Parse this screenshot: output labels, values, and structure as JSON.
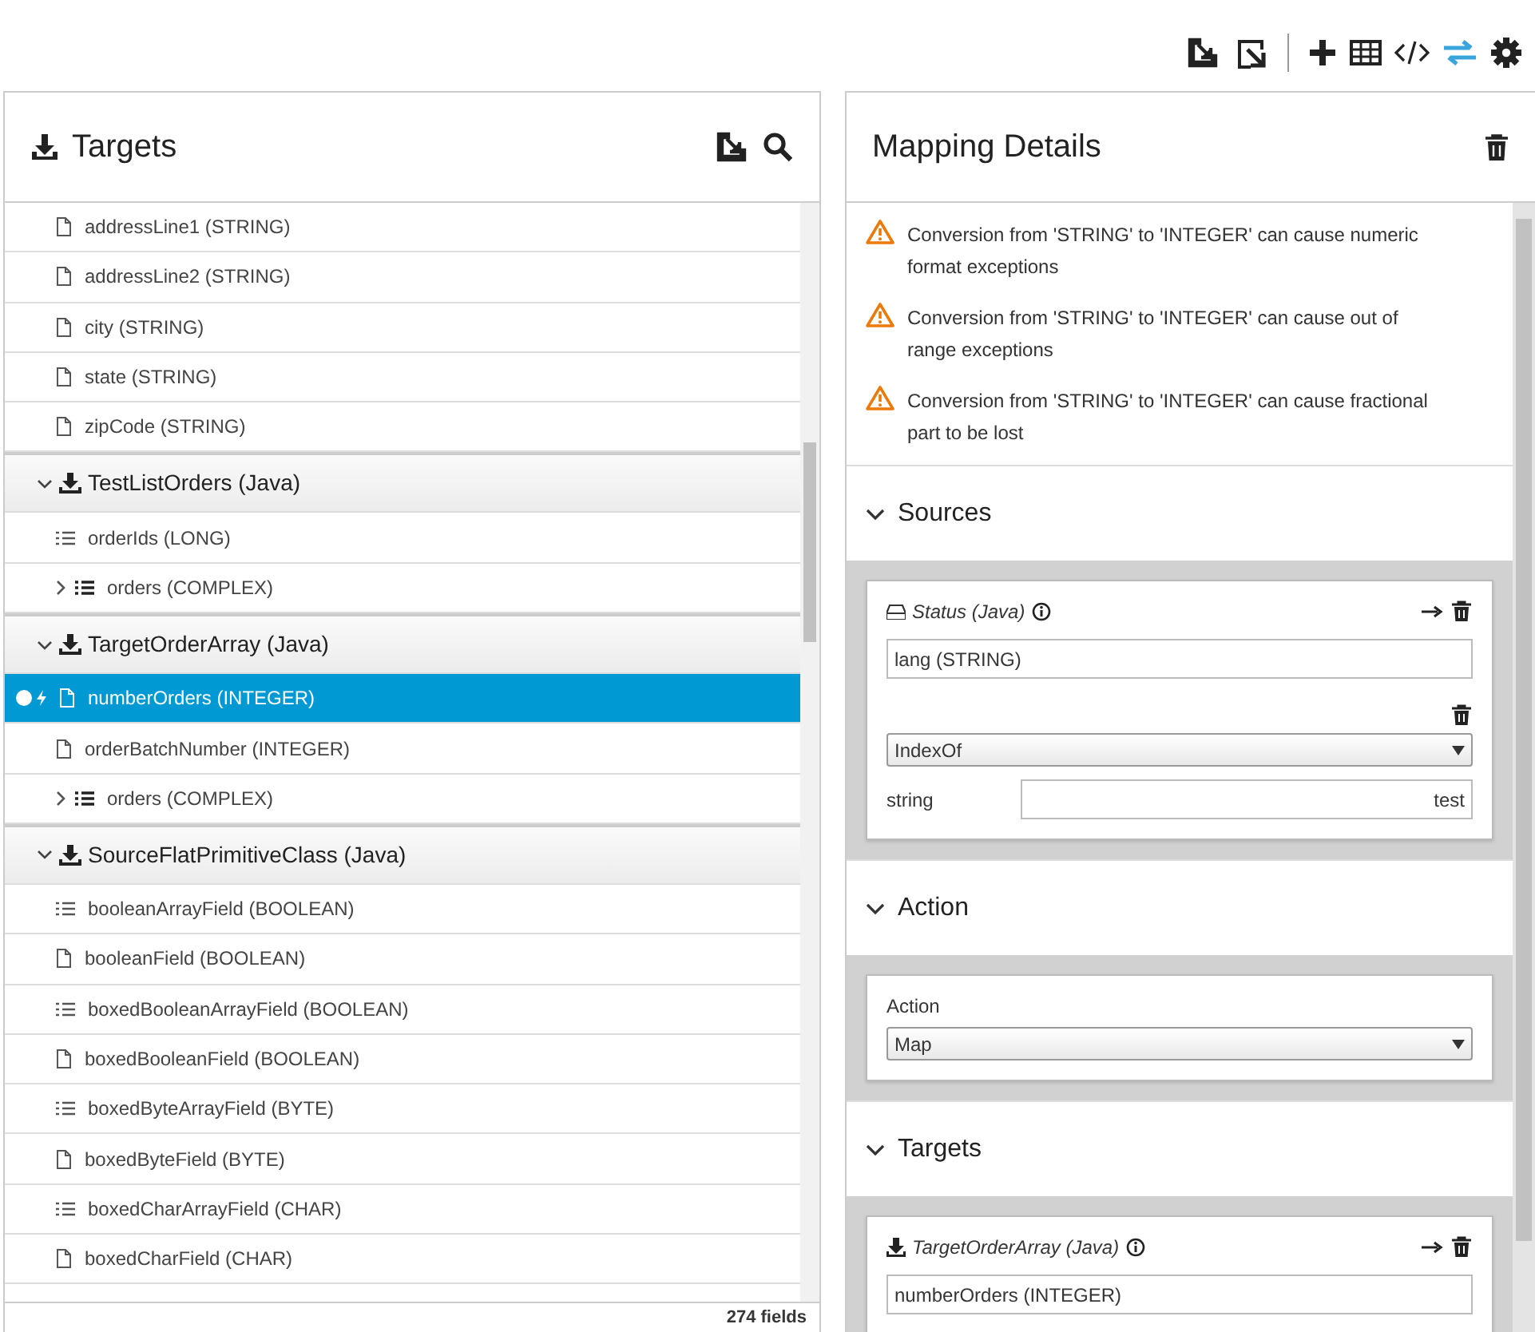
{
  "toolbar": [
    {
      "kind": "import",
      "active": false
    },
    {
      "kind": "export",
      "active": false
    },
    {
      "kind": "separator"
    },
    {
      "kind": "add",
      "active": false
    },
    {
      "kind": "table",
      "active": false
    },
    {
      "kind": "code",
      "active": false
    },
    {
      "kind": "mappings",
      "active": true
    },
    {
      "kind": "settings",
      "active": false
    }
  ],
  "targets_panel": {
    "title": "Targets",
    "footer": "274 fields",
    "tree": [
      {
        "kind": "field",
        "label": "addressLine1 (STRING)",
        "selected": false,
        "mapped": false
      },
      {
        "kind": "field",
        "label": "addressLine2 (STRING)",
        "selected": false,
        "mapped": false
      },
      {
        "kind": "field",
        "label": "city (STRING)",
        "selected": false,
        "mapped": false
      },
      {
        "kind": "field",
        "label": "state (STRING)",
        "selected": false,
        "mapped": false
      },
      {
        "kind": "field",
        "label": "zipCode (STRING)",
        "selected": false,
        "mapped": false
      },
      {
        "kind": "group",
        "label": "TestListOrders (Java)",
        "expanded": true,
        "children": [
          {
            "kind": "collection",
            "label": "orderIds (LONG)",
            "selected": false,
            "mapped": false
          },
          {
            "kind": "complex",
            "label": "orders (COMPLEX)",
            "selected": false,
            "mapped": false,
            "expanded": false
          }
        ]
      },
      {
        "kind": "group",
        "label": "TargetOrderArray (Java)",
        "expanded": true,
        "children": [
          {
            "kind": "field",
            "label": "numberOrders (INTEGER)",
            "selected": true,
            "mapped": true
          },
          {
            "kind": "field",
            "label": "orderBatchNumber (INTEGER)",
            "selected": false,
            "mapped": false
          },
          {
            "kind": "complex",
            "label": "orders (COMPLEX)",
            "selected": false,
            "mapped": false,
            "expanded": false
          }
        ]
      },
      {
        "kind": "group",
        "label": "SourceFlatPrimitiveClass (Java)",
        "expanded": true,
        "children": [
          {
            "kind": "collection",
            "label": "booleanArrayField (BOOLEAN)",
            "selected": false,
            "mapped": false
          },
          {
            "kind": "field",
            "label": "booleanField (BOOLEAN)",
            "selected": false,
            "mapped": false
          },
          {
            "kind": "collection",
            "label": "boxedBooleanArrayField (BOOLEAN)",
            "selected": false,
            "mapped": false
          },
          {
            "kind": "field",
            "label": "boxedBooleanField (BOOLEAN)",
            "selected": false,
            "mapped": false
          },
          {
            "kind": "collection",
            "label": "boxedByteArrayField (BYTE)",
            "selected": false,
            "mapped": false
          },
          {
            "kind": "field",
            "label": "boxedByteField (BYTE)",
            "selected": false,
            "mapped": false
          },
          {
            "kind": "collection",
            "label": "boxedCharArrayField (CHAR)",
            "selected": false,
            "mapped": false
          },
          {
            "kind": "field",
            "label": "boxedCharField (CHAR)",
            "selected": false,
            "mapped": false
          }
        ]
      }
    ]
  },
  "mapping_details": {
    "title": "Mapping Details",
    "warnings": [
      "Conversion from 'STRING' to 'INTEGER' can cause numeric format exceptions",
      "Conversion from 'STRING' to 'INTEGER' can cause out of range exceptions",
      "Conversion from 'STRING' to 'INTEGER' can cause fractional part to be lost"
    ],
    "sections": [
      {
        "kind": "fields",
        "title": "Sources",
        "expanded": true,
        "document": {
          "kind": "source",
          "title": "Status (Java)"
        },
        "field": "lang (STRING)",
        "transformation": "IndexOf",
        "parameter_label": "string",
        "parameter_value": "test"
      },
      {
        "kind": "action",
        "title": "Action",
        "expanded": true,
        "label": "Action",
        "value": "Map"
      },
      {
        "kind": "fields",
        "title": "Targets",
        "expanded": true,
        "document": {
          "kind": "target",
          "title": "TargetOrderArray (Java)"
        },
        "field": "numberOrders (INTEGER)"
      }
    ]
  }
}
